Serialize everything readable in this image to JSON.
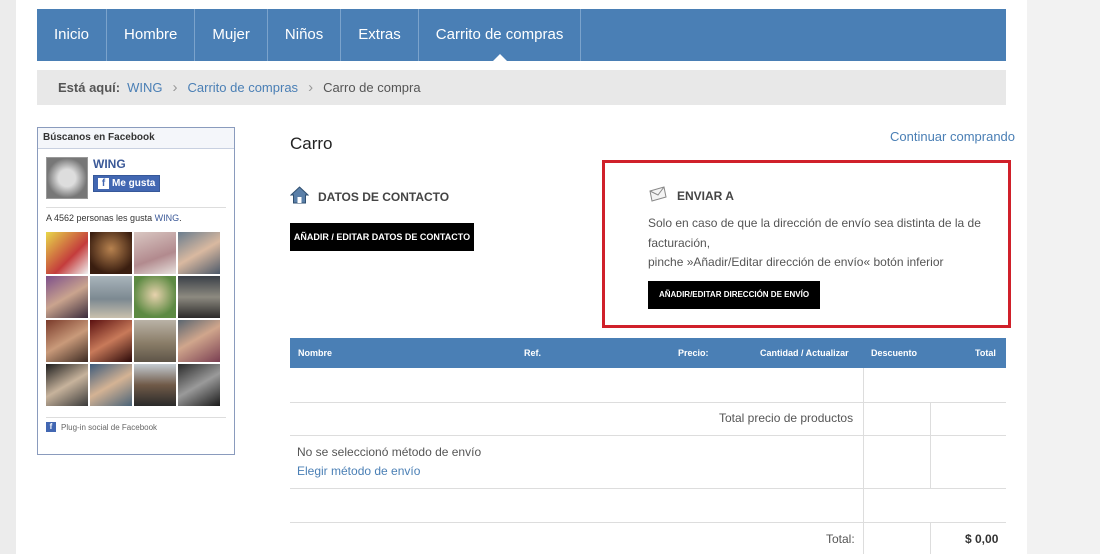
{
  "nav": {
    "items": [
      {
        "label": "Inicio"
      },
      {
        "label": "Hombre"
      },
      {
        "label": "Mujer"
      },
      {
        "label": "Niños"
      },
      {
        "label": "Extras"
      },
      {
        "label": "Carrito de compras"
      }
    ],
    "active": "Carrito de compras"
  },
  "breadcrumb": {
    "label": "Está aquí:",
    "items": [
      "WING",
      "Carrito de compras",
      "Carro de compra"
    ]
  },
  "facebook": {
    "header": "Búscanos en Facebook",
    "page_name": "WING",
    "like_label": "Me gusta",
    "count_prefix": "A 4562 personas les gusta ",
    "count_link": "WING",
    "count_suffix": ".",
    "plugin_label": "Plug-in social de Facebook"
  },
  "main": {
    "title": "Carro",
    "continue_link": "Continuar comprando",
    "contact": {
      "title": "DATOS DE CONTACTO",
      "button": "AÑADIR / EDITAR DATOS DE CONTACTO"
    },
    "shipping": {
      "title": "ENVIAR A",
      "line1": "Solo en caso de que la dirección de envío sea distinta de la de facturación,",
      "line2": "pinche »Añadir/Editar dirección de envío« botón inferior",
      "button": "AÑADIR/EDITAR DIRECCIÓN DE ENVÍO"
    }
  },
  "table": {
    "headers": {
      "nombre": "Nombre",
      "ref": "Ref.",
      "precio": "Precio:",
      "cantidad": "Cantidad / Actualizar",
      "descuento": "Descuento",
      "total": "Total"
    },
    "total_productos_label": "Total precio de productos",
    "no_envio": "No se seleccionó método de envío",
    "elegir_envio": "Elegir método de envío",
    "total_label": "Total:",
    "total_value": "$ 0,00"
  },
  "colors": {
    "nav_bg": "#4a7fb5",
    "highlight_border": "#d0202a",
    "button_bg": "#000000"
  }
}
